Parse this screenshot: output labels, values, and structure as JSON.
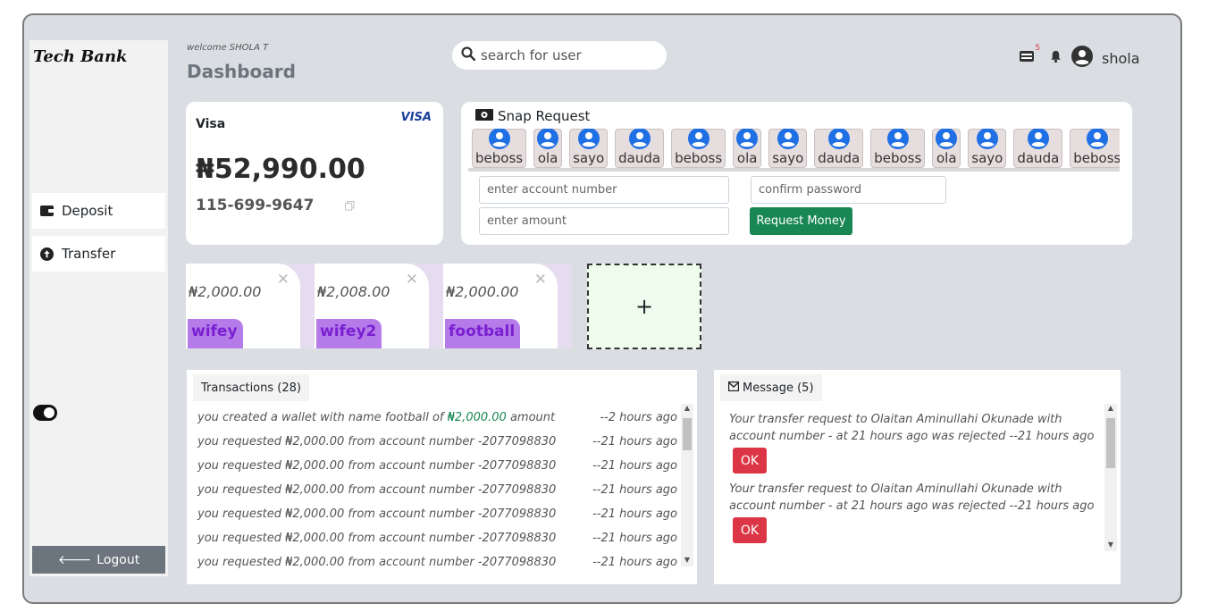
{
  "app": {
    "brand": "Tech Bank"
  },
  "sidebar": {
    "items": [
      {
        "label": "Deposit",
        "icon": "wallet-icon"
      },
      {
        "label": "Transfer",
        "icon": "arrow-up-circle-icon"
      }
    ],
    "logout_label": "Logout"
  },
  "header": {
    "welcome": "welcome SHOLA T",
    "title": "Dashboard",
    "search_placeholder": "search for user",
    "mail_badge": "5",
    "username": "shola"
  },
  "card": {
    "type": "Visa",
    "brand": "VISA",
    "balance": "₦52,990.00",
    "account_number": "115-699-9647"
  },
  "snap": {
    "title": "Snap Request",
    "users": [
      "beboss",
      "ola",
      "sayo",
      "dauda",
      "beboss",
      "ola",
      "sayo",
      "dauda",
      "beboss",
      "ola",
      "sayo",
      "dauda",
      "beboss"
    ],
    "account_placeholder": "enter account number",
    "password_placeholder": "confirm password",
    "amount_placeholder": "enter amount",
    "request_label": "Request Money"
  },
  "wallets": [
    {
      "amount": "₦2,000.00",
      "name": "wifey"
    },
    {
      "amount": "₦2,008.00",
      "name": "wifey2"
    },
    {
      "amount": "₦2,000.00",
      "name": "football"
    }
  ],
  "add_wallet_label": "+",
  "transactions": {
    "tab_label": "Transactions (28)",
    "rows": [
      {
        "pre": "you created a wallet with name football of ",
        "amount": "₦2,000.00",
        "post": " amount",
        "time": "--2 hours ago"
      },
      {
        "pre": "you requested ₦2,000.00 from account number -2077098830",
        "amount": "",
        "post": "",
        "time": "--21 hours ago"
      },
      {
        "pre": "you requested ₦2,000.00 from account number -2077098830",
        "amount": "",
        "post": "",
        "time": "--21 hours ago"
      },
      {
        "pre": "you requested ₦2,000.00 from account number -2077098830",
        "amount": "",
        "post": "",
        "time": "--21 hours ago"
      },
      {
        "pre": "you requested ₦2,000.00 from account number -2077098830",
        "amount": "",
        "post": "",
        "time": "--21 hours ago"
      },
      {
        "pre": "you requested ₦2,000.00 from account number -2077098830",
        "amount": "",
        "post": "",
        "time": "--21 hours ago"
      },
      {
        "pre": "you requested ₦2,000.00 from account number -2077098830",
        "amount": "",
        "post": "",
        "time": "--21 hours ago"
      }
    ]
  },
  "messages": {
    "tab_label": "Message (5)",
    "items": [
      {
        "text": "Your transfer request to Olaitan Aminullahi Okunade with account number - at 21 hours ago was rejected --21 hours ago",
        "button": "OK"
      },
      {
        "text": "Your transfer request to Olaitan Aminullahi Okunade with account number - at 21 hours ago was rejected --21 hours ago",
        "button": "OK"
      }
    ]
  },
  "colors": {
    "background": "#dadde2",
    "success": "#198754",
    "danger": "#dc3545",
    "wallet_tag": "#b57ce9",
    "secondary": "#6c757d"
  }
}
